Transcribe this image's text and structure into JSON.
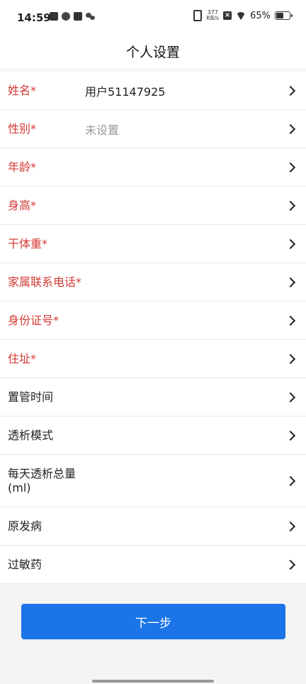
{
  "status_bar": {
    "time": "14:59",
    "net_speed_value": "377",
    "net_speed_unit": "KB/s",
    "battery_percent": "65%",
    "battery_level": 0.65,
    "icons": [
      "notification-app-icon",
      "sync-app-icon",
      "mail-icon",
      "wechat-icon",
      "vibrate-icon",
      "no-sim-icon",
      "wifi-icon",
      "battery-icon"
    ]
  },
  "header": {
    "title": "个人设置"
  },
  "form": {
    "rows": [
      {
        "label": "姓名*",
        "value": "用户51147925",
        "required": true
      },
      {
        "label": "性别*",
        "value": "未设置",
        "required": true
      },
      {
        "label": "年龄*",
        "value": "",
        "required": true
      },
      {
        "label": "身高*",
        "value": "",
        "required": true
      },
      {
        "label": "干体重*",
        "value": "",
        "required": true
      },
      {
        "label": "家属联系电话*",
        "value": "",
        "required": true
      },
      {
        "label": "身份证号*",
        "value": "",
        "required": true
      },
      {
        "label": "住址*",
        "value": "",
        "required": true
      },
      {
        "label": "置管时间",
        "value": "",
        "required": false
      },
      {
        "label": "透析模式",
        "value": "",
        "required": false
      },
      {
        "label": "每天透析总量(ml)",
        "value": "",
        "required": false
      },
      {
        "label": "原发病",
        "value": "",
        "required": false
      },
      {
        "label": "过敏药",
        "value": "",
        "required": false
      }
    ]
  },
  "actions": {
    "next_label": "下一步"
  },
  "colors": {
    "required_label": "#d33a34",
    "primary_button": "#1b74e8"
  }
}
